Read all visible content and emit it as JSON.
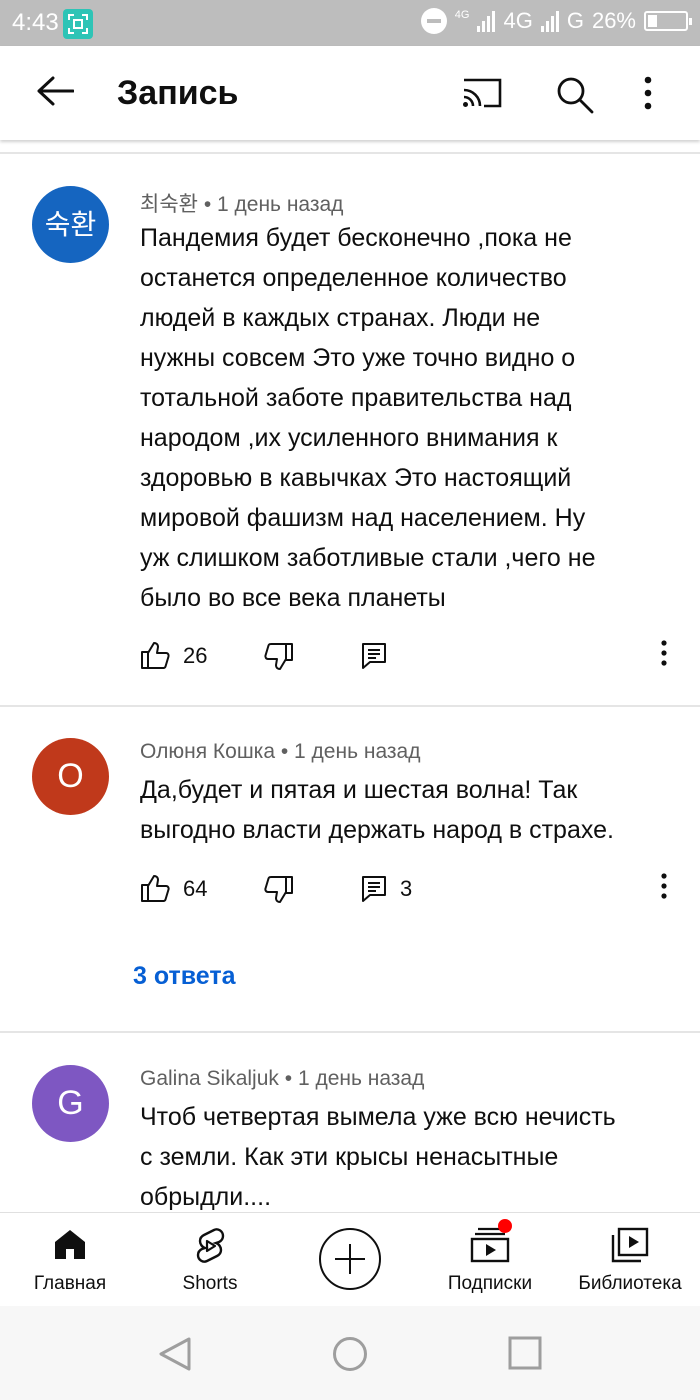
{
  "status_bar": {
    "time": "4:43",
    "net1_top": "4G",
    "net2": "4G",
    "net3": "G",
    "battery": "26%",
    "battery_level": 0.26
  },
  "app_bar": {
    "title": "Запись"
  },
  "comments": [
    {
      "author": "최숙환",
      "avatar_text": "숙환",
      "avatar_color": "#1565c0",
      "time": "1 день назад",
      "lines": [
        "Пандемия будет бесконечно ,пока не",
        "останется определенное  количество",
        "людей в каждых странах. Люди не",
        "нужны совсем Это уже точно видно о",
        "тотальной заботе правительства над",
        "народом ,их усиленного внимания к",
        "здоровью в кавычках Это настоящий",
        "мировой фашизм над населением. Ну",
        "уж слишком заботливые стали ,чего не",
        "было во все века планеты"
      ],
      "likes": "26",
      "replies_count": ""
    },
    {
      "author": "Олюня Кошка",
      "avatar_text": "О",
      "avatar_color": "#c0391b",
      "time": "1 день назад",
      "lines": [
        "Да,будет и пятая и шестая волна! Так",
        "выгодно власти держать народ в страхе."
      ],
      "likes": "64",
      "replies_count": "3",
      "replies_link": "3 ответа"
    },
    {
      "author": "Galina Sikaljuk",
      "avatar_text": "G",
      "avatar_color": "#7e57c2",
      "time": "1 день назад",
      "lines": [
        "Чтоб четвертая вымела уже всю нечисть",
        "с земли. Как эти крысы ненасытные",
        "обрыдли...."
      ]
    }
  ],
  "bottom_nav": [
    {
      "label": "Главная",
      "icon": "home-icon"
    },
    {
      "label": "Shorts",
      "icon": "shorts-icon"
    },
    {
      "label": "",
      "icon": "create-icon"
    },
    {
      "label": "Подписки",
      "icon": "subscriptions-icon"
    },
    {
      "label": "Библиотека",
      "icon": "library-icon"
    }
  ],
  "colors": {
    "link": "#065fd4",
    "notification_dot": "#ff0000",
    "status_bar": "#bdbdbd"
  }
}
